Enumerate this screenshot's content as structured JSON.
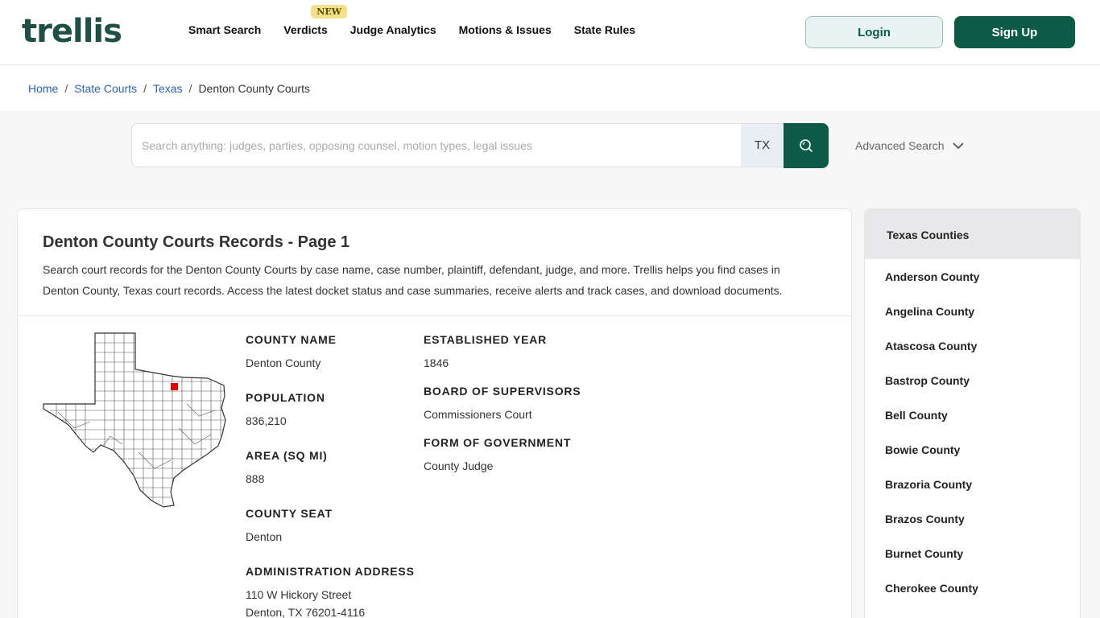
{
  "header": {
    "logo_text": "trellis",
    "nav": [
      {
        "label": "Smart Search"
      },
      {
        "label": "Verdicts",
        "badge": "NEW"
      },
      {
        "label": "Judge Analytics"
      },
      {
        "label": "Motions & Issues"
      },
      {
        "label": "State Rules"
      }
    ],
    "login_label": "Login",
    "signup_label": "Sign Up"
  },
  "breadcrumb": {
    "items": [
      "Home",
      "State Courts",
      "Texas"
    ],
    "current": "Denton County Courts",
    "separator": "/"
  },
  "search": {
    "placeholder": "Search anything: judges, parties, opposing counsel, motion types, legal issues",
    "value": "",
    "state": "TX",
    "advanced_label": "Advanced Search"
  },
  "main": {
    "title": "Denton County Courts Records - Page 1",
    "description": "Search court records for the Denton County Courts by case name, case number, plaintiff, defendant, judge, and more. Trellis helps you find cases in Denton County, Texas court records. Access the latest docket status and case summaries, receive alerts and track cases, and download documents.",
    "fields": {
      "county_name": {
        "label": "COUNTY NAME",
        "value": "Denton County"
      },
      "population": {
        "label": "POPULATION",
        "value": "836,210"
      },
      "area": {
        "label": "AREA (SQ MI)",
        "value": "888"
      },
      "county_seat": {
        "label": "COUNTY SEAT",
        "value": "Denton"
      },
      "admin_address": {
        "label": "ADMINISTRATION ADDRESS",
        "line1": "110 W Hickory Street",
        "line2": "Denton, TX 76201-4116"
      },
      "established": {
        "label": "ESTABLISHED YEAR",
        "value": "1846"
      },
      "board": {
        "label": "BOARD OF SUPERVISORS",
        "value": "Commissioners Court"
      },
      "government": {
        "label": "FORM OF GOVERNMENT",
        "value": "County Judge"
      }
    }
  },
  "sidebar": {
    "title": "Texas Counties",
    "counties": [
      "Anderson County",
      "Angelina County",
      "Atascosa County",
      "Bastrop County",
      "Bell County",
      "Bowie County",
      "Brazoria County",
      "Brazos County",
      "Burnet County",
      "Cherokee County"
    ]
  },
  "colors": {
    "brand_green": "#0d5a47",
    "link_blue": "#2a62b0",
    "highlight_county": "#e00000"
  }
}
